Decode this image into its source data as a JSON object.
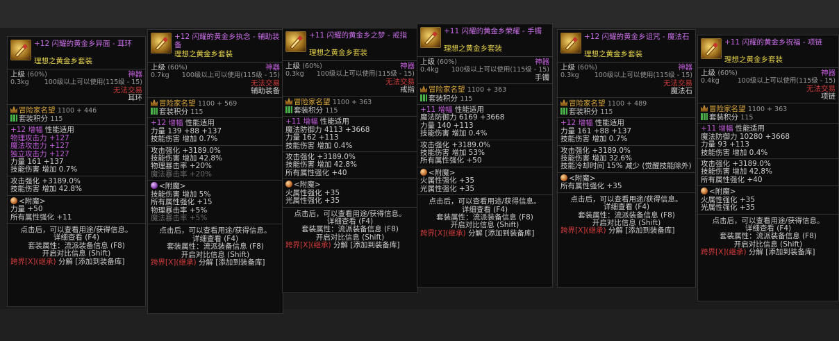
{
  "panels": [
    {
      "title": "+12 闪耀的黄金乡异面 - 耳环",
      "set": "理想之黄金乡套装",
      "grade": "上级",
      "grade_pct": "(60%)",
      "rarity": "神器",
      "weight": "0.3kg",
      "level_req": "100级以上可以使用(115级 - 15)",
      "trade": "无法交易",
      "slot": "耳环",
      "fame_label": "冒险家名望",
      "fame_value": "1100 + 446",
      "set_points_label": "套装积分",
      "set_points_value": "115",
      "amp_head": "+12",
      "amp_label": "增幅",
      "amp_desc": "性能适用",
      "amp_lines": [
        "物理攻击力 +127",
        "魔法攻击力 +127",
        "独立攻击力 +127"
      ],
      "stat_line": "力量 161 +137",
      "skill_line": "技能伤害 增加 0.7%",
      "main_lines": [
        "攻击强化 +3189.0%",
        "技能伤害 增加 42.8%"
      ],
      "enchant_label": "<附魔>",
      "enchant_lines": [
        "力量 +50",
        "所有属性强化 +11"
      ],
      "footer": [
        "点击后，可以查看用途/获得信息。",
        "详细查看 (F4)",
        "套装属性：流派装备信息 (F8)",
        "开启对比信息 (Shift)"
      ],
      "bottom": [
        "跨界[X](继承)",
        "分解",
        "[添加到装备库]"
      ]
    },
    {
      "title": "+12 闪耀的黄金乡执念 - 辅助装备",
      "set": "理想之黄金乡套装",
      "grade": "上级",
      "grade_pct": "(60%)",
      "rarity": "神器",
      "weight": "0.7kg",
      "level_req": "100级以上可以使用(115级 - 15)",
      "trade": "无法交易",
      "slot": "辅助装备",
      "fame_label": "冒险家名望",
      "fame_value": "1100 + 569",
      "set_points_label": "套装积分",
      "set_points_value": "115",
      "amp_head": "+12",
      "amp_label": "增幅",
      "amp_desc": "性能适用",
      "stat_line": "力量 139 +88 +137",
      "skill_line": "技能伤害 增加 0.7%",
      "main_lines": [
        "攻击强化 +3189.0%",
        "技能伤害 增加 42.8%",
        "物理暴击率 +20%",
        "魔法暴击率 +20%"
      ],
      "enchant_label": "<附魔>",
      "enchant_lines": [
        "技能伤害 增加 5%",
        "所有属性强化 +15",
        "物理暴击率 +5%",
        "魔法暴击率 +5%"
      ],
      "footer": [
        "点击后，可以查看用途/获得信息。",
        "详细查看 (F4)",
        "套装属性：流派装备信息 (F8)",
        "开启对比信息 (Shift)"
      ],
      "bottom": [
        "跨界[X](继承)",
        "分解",
        "[添加到装备库]"
      ]
    },
    {
      "title": "+11 闪耀的黄金乡之梦 - 戒指",
      "set": "理想之黄金乡套装",
      "grade": "上级",
      "grade_pct": "(60%)",
      "rarity": "神器",
      "weight": "0.3kg",
      "level_req": "100级以上可以使用(115级 - 15)",
      "trade": "无法交易",
      "slot": "戒指",
      "fame_label": "冒险家名望",
      "fame_value": "1100 + 363",
      "set_points_label": "套装积分",
      "set_points_value": "115",
      "amp_head": "+11",
      "amp_label": "增幅",
      "amp_desc": "性能适用",
      "stat_line1": "魔法防御力 4113 +3668",
      "stat_line": "力量 162 +113",
      "skill_line": "技能伤害 增加 0.4%",
      "main_lines": [
        "攻击强化 +3189.0%",
        "技能伤害 增加 42.8%",
        "所有属性强化 +40"
      ],
      "enchant_label": "<附魔>",
      "enchant_lines": [
        "火属性强化 +35",
        "光属性强化 +35"
      ],
      "footer": [
        "点击后，可以查看用途/获得信息。",
        "详细查看 (F4)",
        "套装属性：流派装备信息 (F8)",
        "开启对比信息 (Shift)"
      ],
      "bottom": [
        "跨界[X](继承)",
        "分解",
        "[添加到装备库]"
      ]
    },
    {
      "title": "+11 闪耀的黄金乡荣耀 - 手镯",
      "set": "理想之黄金乡套装",
      "grade": "上级",
      "grade_pct": "(60%)",
      "rarity": "神器",
      "weight": "0.4kg",
      "level_req": "100级以上可以使用(115级 - 15)",
      "trade": "",
      "slot": "手镯",
      "fame_label": "冒险家名望",
      "fame_value": "1100 + 363",
      "set_points_label": "套装积分",
      "set_points_value": "115",
      "amp_head": "+11",
      "amp_label": "增幅",
      "amp_desc": "性能适用",
      "stat_line1": "魔法防御力 6169 +3668",
      "stat_line": "力量 140 +113",
      "skill_line": "技能伤害 增加 0.4%",
      "main_lines": [
        "攻击强化 +3189.0%",
        "技能伤害 增加 53%",
        "所有属性强化 +50"
      ],
      "enchant_label": "<附魔>",
      "enchant_lines": [
        "火属性强化 +35",
        "光属性强化 +35"
      ],
      "footer": [
        "点击后，可以查看用途/获得信息。",
        "详细查看 (F4)",
        "套装属性：流派装备信息 (F8)",
        "开启对比信息 (Shift)"
      ],
      "bottom": [
        "跨界[X](继承)",
        "分解",
        "[添加到装备库]"
      ]
    },
    {
      "title": "+12 闪耀的黄金乡诅咒 - 魔法石",
      "set": "理想之黄金乡套装",
      "grade": "上级",
      "grade_pct": "(60%)",
      "rarity": "神器",
      "weight": "0.3kg",
      "level_req": "100级以上可以使用(115级 - 15)",
      "trade": "无法交易",
      "slot": "魔法石",
      "fame_label": "冒险家名望",
      "fame_value": "1100 + 489",
      "set_points_label": "套装积分",
      "set_points_value": "115",
      "amp_head": "+12",
      "amp_label": "增幅",
      "amp_desc": "性能适用",
      "stat_line": "力量 161 +88 +137",
      "skill_line": "技能伤害 增加 0.7%",
      "main_lines": [
        "攻击强化 +3189.0%",
        "技能伤害 增加 32.6%",
        "技能冷却时间 15% 减少 (觉醒技能除外)"
      ],
      "enchant_label": "<附魔>",
      "enchant_lines": [
        "所有属性强化 +35"
      ],
      "footer": [
        "点击后，可以查看用途/获得信息。",
        "详细查看 (F4)",
        "套装属性：流派装备信息 (F8)",
        "开启对比信息 (Shift)"
      ],
      "bottom": [
        "跨界[X](继承)",
        "分解",
        "[添加到装备库]"
      ]
    },
    {
      "title": "+11 闪耀的黄金乡祝福 - 项链",
      "set": "理想之黄金乡套装",
      "grade": "上级",
      "grade_pct": "(60%)",
      "rarity": "神器",
      "weight": "0.4kg",
      "level_req": "100级以上可以使用(115级 - 15)",
      "trade": "无法交易",
      "slot": "项链",
      "fame_label": "冒险家名望",
      "fame_value": "1100 + 363",
      "set_points_label": "套装积分",
      "set_points_value": "115",
      "amp_head": "+11",
      "amp_label": "增幅",
      "amp_desc": "性能适用",
      "stat_line1": "魔法防御力 10280 +3668",
      "stat_line": "力量 93 +113",
      "skill_line": "技能伤害 增加 0.4%",
      "main_lines": [
        "攻击强化 +3189.0%",
        "技能伤害 增加 42.8%",
        "所有属性强化 +40"
      ],
      "enchant_label": "<附魔>",
      "enchant_lines": [
        "火属性强化 +35",
        "光属性强化 +35"
      ],
      "footer": [
        "点击后，可以查看用途/获得信息。",
        "详细查看 (F4)",
        "套装属性：流派装备信息 (F8)",
        "开启对比信息 (Shift)"
      ],
      "bottom": [
        "跨界[X](继承)",
        "分解",
        "[添加到装备库]"
      ]
    }
  ]
}
